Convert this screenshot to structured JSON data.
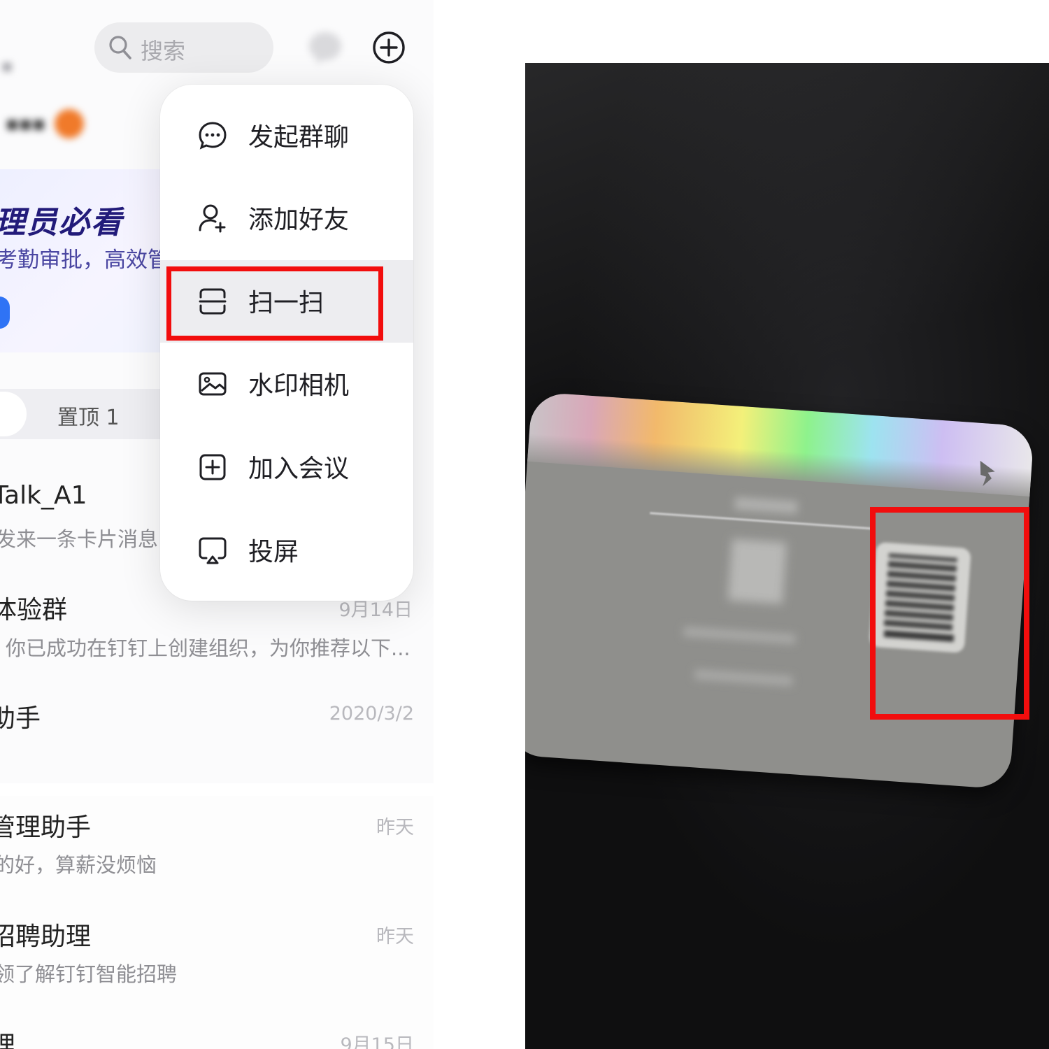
{
  "app": {
    "search": {
      "placeholder": "搜索",
      "icon": "search-icon"
    },
    "top_icons": [
      "chat-bubble-icon",
      "plus-circle-icon"
    ]
  },
  "banner": {
    "title": "理员必看",
    "subtitle": "考勤审批，高效管"
  },
  "tabs": {
    "pinned_label": "置顶 1"
  },
  "chat_list": [
    {
      "title": "Talk_A1",
      "subtitle": "发来一条卡片消息",
      "time": ""
    },
    {
      "title": "体验群",
      "subtitle": "你已成功在钉钉上创建组织，为你推荐以下...",
      "time": "9月14日"
    },
    {
      "title": "助手",
      "subtitle": "",
      "time": "2020/3/2"
    },
    {
      "title": "管理助手",
      "subtitle": "的好，算薪没烦恼",
      "time": "昨天"
    },
    {
      "title": "招聘助理",
      "subtitle": "领了解钉钉智能招聘",
      "time": "昨天"
    },
    {
      "title": "理",
      "subtitle": "",
      "time": "9月15日"
    }
  ],
  "menu": {
    "items": [
      {
        "label": "发起群聊",
        "icon": "group-chat-icon"
      },
      {
        "label": "添加好友",
        "icon": "add-friend-icon"
      },
      {
        "label": "扫一扫",
        "icon": "scan-icon",
        "selected": true
      },
      {
        "label": "水印相机",
        "icon": "watermark-camera-icon"
      },
      {
        "label": "加入会议",
        "icon": "join-meeting-icon"
      },
      {
        "label": "投屏",
        "icon": "screen-cast-icon"
      }
    ]
  },
  "colors": {
    "highlight": "#f20d0d",
    "banner_title": "#221b7a",
    "badge": "#f07a2a",
    "accent_blue": "#2f73f5"
  }
}
